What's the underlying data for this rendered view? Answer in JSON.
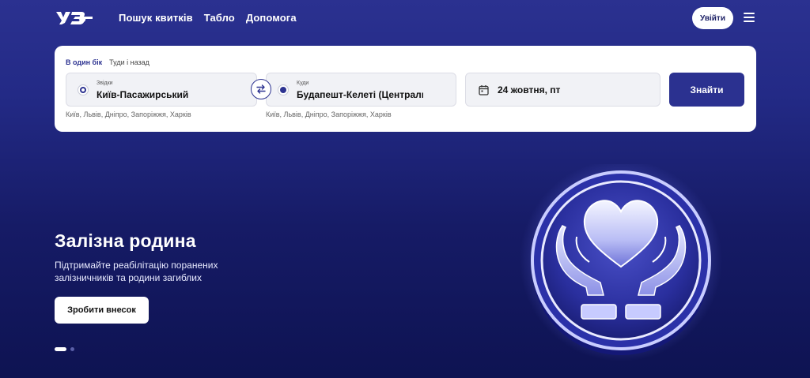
{
  "header": {
    "logo_text": "УЗ",
    "nav": [
      "Пошук квитків",
      "Табло",
      "Допомога"
    ],
    "login_label": "Увійти",
    "menu_icon": "hamburger-icon"
  },
  "search": {
    "trip_types": [
      "В один бік",
      "Туди і назад"
    ],
    "active_trip_type": "В один бік",
    "from": {
      "label": "Звідки",
      "value": "Київ-Пасажирський",
      "hints": "Київ, Львів, Дніпро, Запоріжжя, Харків"
    },
    "to": {
      "label": "Куди",
      "value": "Будапешт-Келеті (Центральний)",
      "hints": "Київ, Львів, Дніпро, Запоріжжя, Харків"
    },
    "date": "24 жовтня, пт",
    "submit_label": "Знайти"
  },
  "hero": {
    "title": "Залізна родина",
    "subtitle": "Підтримайте реабілітацію поранених залізничників та родини загиблих",
    "cta_label": "Зробити внесок",
    "slides_total": 2,
    "active_slide": 1
  },
  "colors": {
    "brand": "#2b3190",
    "accent_light": "#c9cdff"
  }
}
